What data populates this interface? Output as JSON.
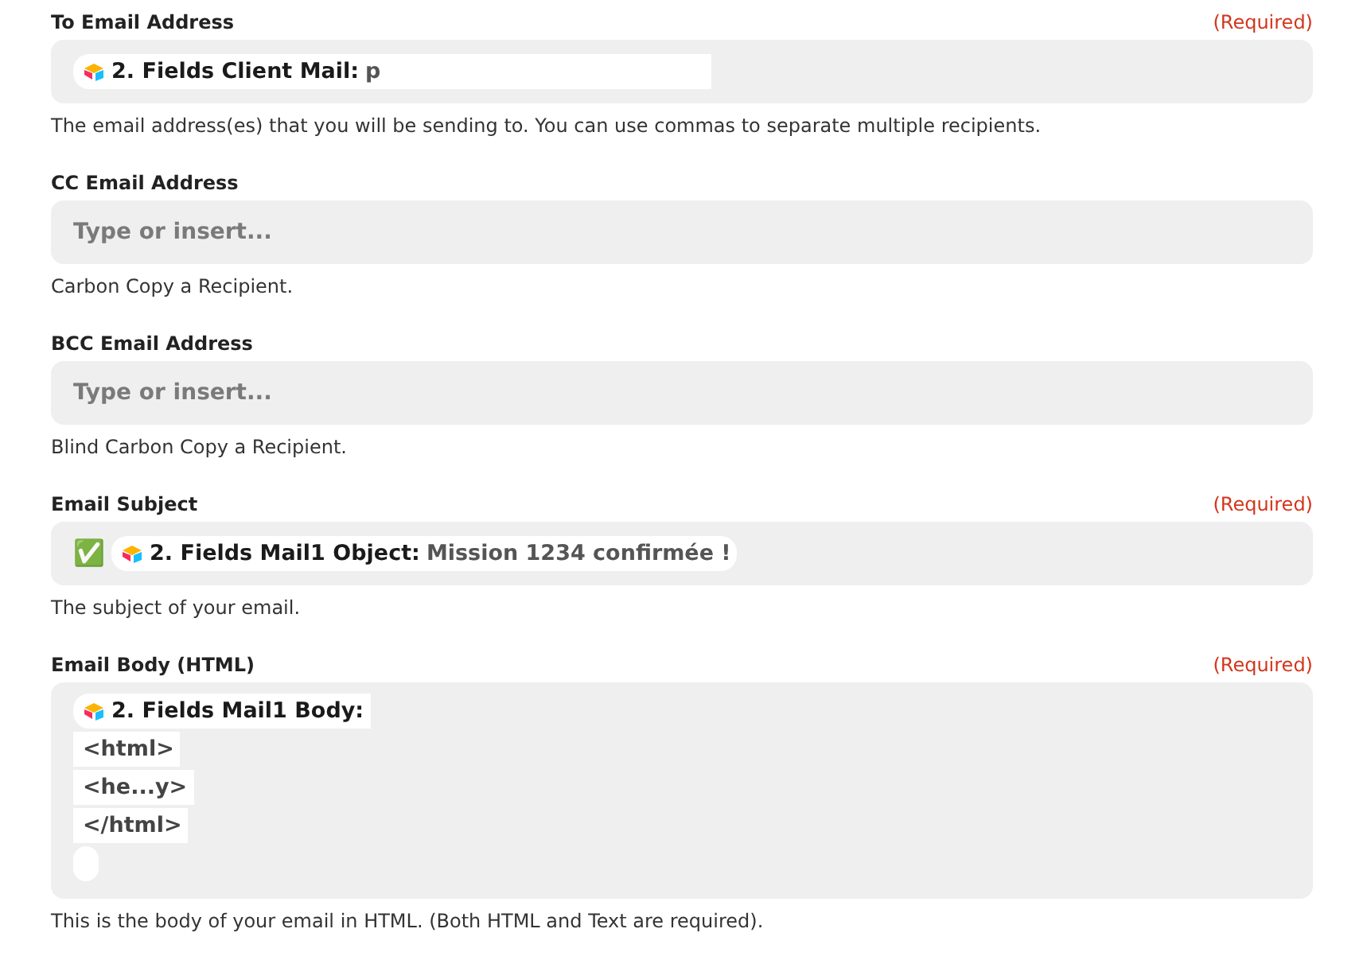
{
  "fields": [
    {
      "label": "To Email Address",
      "required": "(Required)",
      "kind": "pills",
      "pill": {
        "name": "2. Fields Client Mail:",
        "value": "p"
      },
      "help": "The email address(es) that you will be sending to. You can use commas to separate multiple recipients."
    },
    {
      "label": "CC Email Address",
      "kind": "empty",
      "placeholder": "Type or insert...",
      "help": "Carbon Copy a Recipient."
    },
    {
      "label": "BCC Email Address",
      "kind": "empty",
      "placeholder": "Type or insert...",
      "help": "Blind Carbon Copy a Recipient."
    },
    {
      "label": "Email Subject",
      "required": "(Required)",
      "kind": "pills",
      "prefix": "✅",
      "pill": {
        "name": "2. Fields Mail1 Object:",
        "value": "Mission 1234 confirmée !"
      },
      "help": "The subject of your email."
    },
    {
      "label": "Email Body (HTML)",
      "required": "(Required)",
      "kind": "body",
      "pill": {
        "name": "2. Fields Mail1 Body:"
      },
      "lines": [
        "<html>",
        "<he...y>",
        "</html>"
      ],
      "help": "This is the body of your email in HTML. (Both HTML and Text are required)."
    }
  ]
}
